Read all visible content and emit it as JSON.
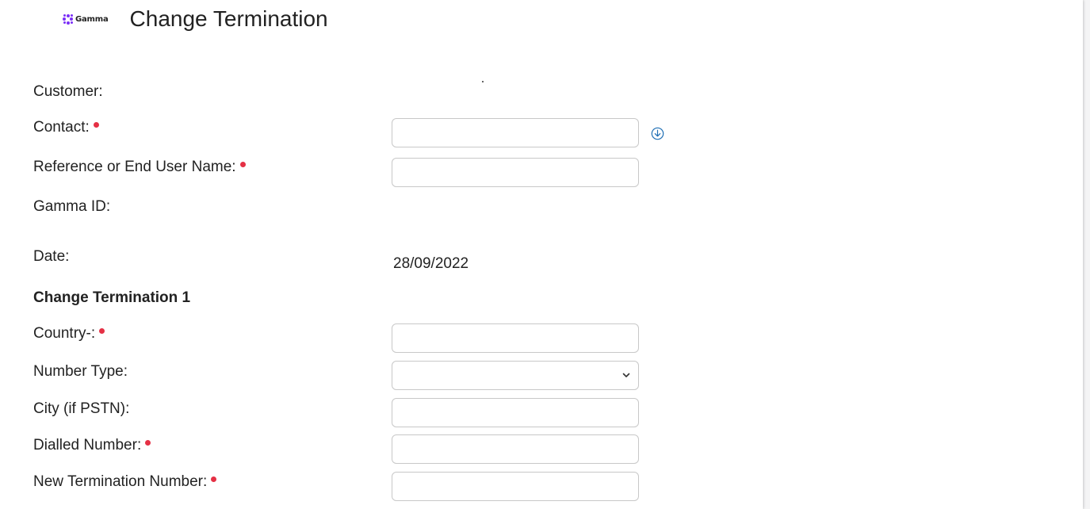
{
  "header": {
    "logo_text": "Gamma",
    "title": "Change Termination"
  },
  "form": {
    "customer_label": "Customer:",
    "contact_label": "Contact:",
    "reference_label": "Reference or End User Name:",
    "gamma_id_label": "Gamma ID:",
    "date_label": "Date:",
    "date_value": "28/09/2022",
    "section_title": "Change Termination 1",
    "country_label": "Country-:",
    "number_type_label": "Number Type:",
    "city_label": "City (if PSTN):",
    "dialled_number_label": "Dialled Number:",
    "new_termination_label": "New Termination Number:"
  },
  "fields": {
    "contact": "",
    "reference": "",
    "country": "",
    "number_type": "",
    "city": "",
    "dialled_number": "",
    "new_termination_number": ""
  },
  "icons": {
    "logo": "gamma-logo-icon",
    "contact_lookup": "circle-arrow-down-icon",
    "select": "chevron-down-icon",
    "required": "required-dot-icon"
  },
  "colors": {
    "required": "#e53045",
    "brand": "#7b2ff7",
    "lookup_icon": "#1f6fb5"
  }
}
